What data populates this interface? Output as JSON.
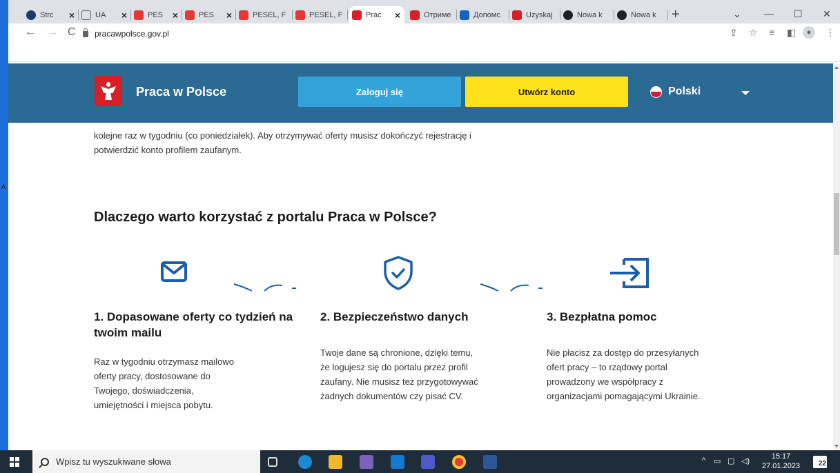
{
  "browser": {
    "tabs": [
      {
        "label": "Strc",
        "color": "#1a3a6b"
      },
      {
        "label": "UA",
        "color": "#5f6368"
      },
      {
        "label": "PES",
        "color": "#e53935"
      },
      {
        "label": "PES",
        "color": "#e53935"
      },
      {
        "label": "PESEL, F",
        "color": "#e53935"
      },
      {
        "label": "PESEL, F",
        "color": "#e53935"
      },
      {
        "label": "Prac",
        "color": "#d61f26"
      },
      {
        "label": "Отриме",
        "color": "#d61f26"
      },
      {
        "label": "Допомс",
        "color": "#1565c0"
      },
      {
        "label": "Uzyskaj",
        "color": "#d61f26"
      },
      {
        "label": "Nowa k",
        "color": "#202124"
      },
      {
        "label": "Nowa k",
        "color": "#202124"
      }
    ],
    "url": "pracawpolsce.gov.pl"
  },
  "site": {
    "brand": "Praca w Polsce",
    "login": "Zaloguj się",
    "create_account": "Utwórz konto",
    "language": "Polski"
  },
  "content": {
    "intro": "kolejne raz w tygodniu (co poniedziałek). Aby otrzymywać oferty musisz dokończyć rejestrację i potwierdzić konto profilem zaufanym.",
    "section_title": "Dlaczego warto korzystać z portalu Praca w Polsce?",
    "features": [
      {
        "title": "1. Dopasowane oferty co tydzień na twoim mailu",
        "text": "Raz w tygodniu otrzymasz mailowo oferty pracy, dostosowane do Twojego, doświadczenia, umiejętności i miejsca pobytu."
      },
      {
        "title": "2. Bezpieczeństwo danych",
        "text": "Twoje dane są chronione, dzięki temu, że logujesz się do portalu przez profil zaufany. Nie musisz też przygotowywać żadnych dokumentów czy pisać CV."
      },
      {
        "title": "3. Bezpłatna pomoc",
        "text": "Nie płacisz za dostęp do przesyłanych ofert pracy – to rządowy portal prowadzony we współpracy z organizacjami pomagającymi Ukrainie."
      }
    ]
  },
  "taskbar": {
    "search_placeholder": "Wpisz tu wyszukiwane słowa",
    "time": "15:17",
    "date": "27.01.2023",
    "notifications": "22"
  },
  "colors": {
    "header": "#2b6a93",
    "login": "#34a3d9",
    "create": "#ffe31a",
    "icon_blue": "#1a5eab"
  }
}
